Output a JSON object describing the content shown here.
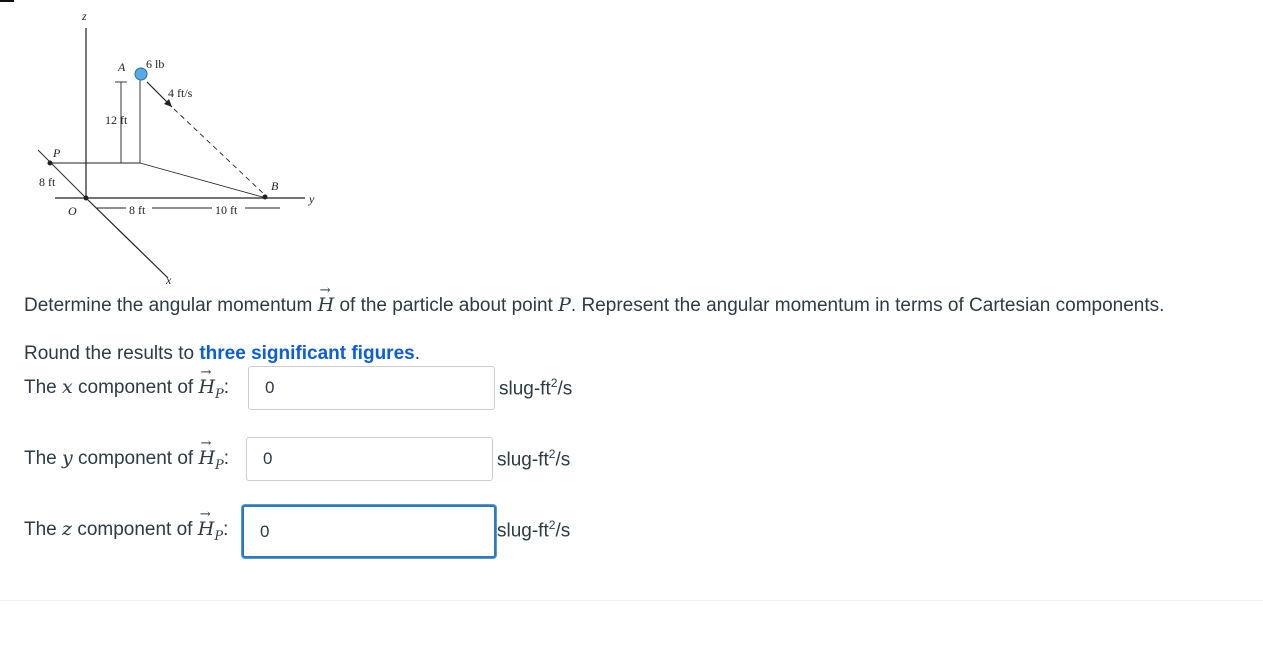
{
  "figure": {
    "labels": {
      "z": "z",
      "x": "x",
      "y": "y",
      "A": "A",
      "B": "B",
      "O": "O",
      "P": "P",
      "weight": "6 lb",
      "speed": "4 ft/s",
      "height": "12 ft",
      "dim_p": "8 ft",
      "dim_ob": "8 ft",
      "dim_b": "10 ft"
    }
  },
  "question": {
    "prefix": "Determine the angular momentum ",
    "H": "H",
    "middle": " of the particle about point ",
    "P": "P",
    "suffix": ". Represent the angular momentum in terms of Cartesian components."
  },
  "instructions": {
    "prefix": "Round the results to ",
    "link": "three significant figures",
    "suffix": "."
  },
  "answers": [
    {
      "pre": "The ",
      "var": "x",
      "post": " component of ",
      "H": "H",
      "sub": "P",
      "colon": ":",
      "value": "0",
      "unit": "slug-ft",
      "unit_exp": "2",
      "unit_tail": "/s"
    },
    {
      "pre": "The ",
      "var": "y",
      "post": " component of ",
      "H": "H",
      "sub": "P",
      "colon": ":",
      "value": "0",
      "unit": "slug-ft",
      "unit_exp": "2",
      "unit_tail": "/s"
    },
    {
      "pre": "The ",
      "var": "z",
      "post": " component of ",
      "H": "H",
      "sub": "P",
      "colon": ":",
      "value": "0",
      "unit": "slug-ft",
      "unit_exp": "2",
      "unit_tail": "/s"
    }
  ],
  "arrow": "→",
  "colors": {
    "link": "#0b5ed7",
    "focus": "#2b7abc",
    "particle": "#5aa9e6"
  }
}
